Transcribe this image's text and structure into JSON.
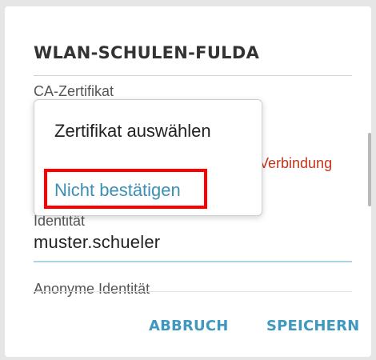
{
  "dialog": {
    "title": "WLAN-SCHULEN-FULDA",
    "ca_certificate": {
      "label": "CA-Zertifikat",
      "warning": "Verbindung"
    },
    "identity": {
      "label": "Identität",
      "value": "muster.schueler"
    },
    "anonymous_identity": {
      "label": "Anonyme Identität"
    },
    "dropdown": {
      "options": [
        "Zertifikat auswählen",
        "Nicht bestätigen"
      ],
      "highlighted_option": "Nicht bestätigen"
    },
    "buttons": {
      "cancel": "ABBRUCH",
      "save": "SPEICHERN"
    }
  },
  "colors": {
    "accent": "#3e98bf",
    "warning": "#c1351b",
    "highlight": "#ff0000"
  }
}
